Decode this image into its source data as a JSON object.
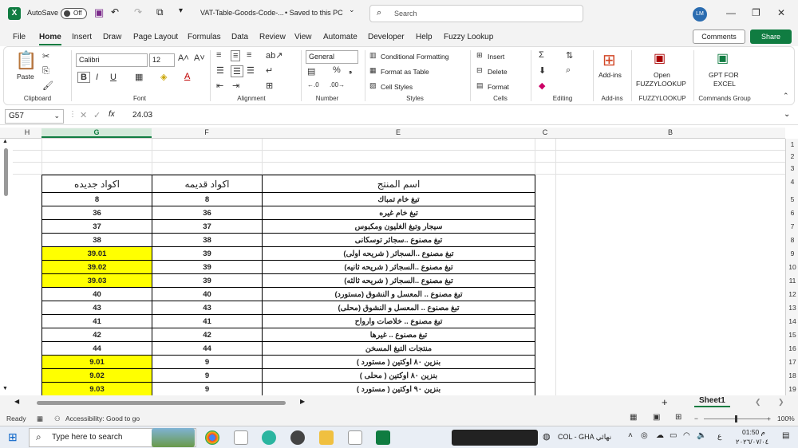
{
  "titlebar": {
    "autosave_label": "AutoSave",
    "autosave_state": "Off",
    "filename": "VAT-Table-Goods-Code-...",
    "save_status": "• Saved to this PC",
    "save_status_chevron": "⌄",
    "search_placeholder": "Search",
    "user_initials": "LM",
    "minimize": "—",
    "restore": "❐",
    "close": "✕"
  },
  "menu": {
    "items": [
      "File",
      "Home",
      "Insert",
      "Draw",
      "Page Layout",
      "Formulas",
      "Data",
      "Review",
      "View",
      "Automate",
      "Developer",
      "Help",
      "Fuzzy Lookup"
    ],
    "comments_label": "Comments",
    "share_label": "Share"
  },
  "ribbon": {
    "clipboard": {
      "paste": "Paste",
      "label": "Clipboard"
    },
    "font": {
      "name": "Calibri",
      "size": "12",
      "bold": "B",
      "italic": "I",
      "underline": "U",
      "label": "Font"
    },
    "alignment": {
      "label": "Alignment"
    },
    "number": {
      "format": "General",
      "label": "Number"
    },
    "styles": {
      "conditional": "Conditional Formatting",
      "format_table": "Format as Table",
      "cell_styles": "Cell Styles",
      "label": "Styles"
    },
    "cells": {
      "insert": "Insert",
      "delete": "Delete",
      "format": "Format",
      "label": "Cells"
    },
    "editing": {
      "label": "Editing"
    },
    "addins": {
      "button": "Add-ins",
      "label": "Add-ins"
    },
    "fuzzy": {
      "button_line1": "Open",
      "button_line2": "FUZZYLOOKUP",
      "label": "FUZZYLOOKUP"
    },
    "gpt": {
      "button_line1": "GPT FOR",
      "button_line2": "EXCEL",
      "label": "Commands Group"
    }
  },
  "formula_bar": {
    "cell_ref": "G57",
    "fx": "fx",
    "value": "24.03"
  },
  "grid": {
    "columns": [
      "H",
      "G",
      "F",
      "E",
      "C",
      "B"
    ],
    "selected_column": "G",
    "rows": [
      "1",
      "2",
      "3",
      "4",
      "5",
      "6",
      "7",
      "8",
      "9",
      "10",
      "11",
      "12",
      "13",
      "14",
      "15",
      "16",
      "17",
      "18",
      "19"
    ]
  },
  "table": {
    "headers": {
      "new_codes": "اكواد جديده",
      "old_codes": "اكواد قديمه",
      "product_name": "اسم المنتج"
    },
    "rows": [
      {
        "new": "8",
        "old": "8",
        "name": "تبغ خام تمباك",
        "highlight": false
      },
      {
        "new": "36",
        "old": "36",
        "name": "تبغ خام غيره",
        "highlight": false
      },
      {
        "new": "37",
        "old": "37",
        "name": "سيجار وتبغ الغليون ومكبوس",
        "highlight": false
      },
      {
        "new": "38",
        "old": "38",
        "name": "تبغ مصنوع ..سجائر توسكانى",
        "highlight": false
      },
      {
        "new": "39.01",
        "old": "39",
        "name": "تبغ مصنوع ..السجائر ( شريحه اولى)",
        "highlight": true
      },
      {
        "new": "39.02",
        "old": "39",
        "name": "تبغ مصنوع ..السجائر ( شريحه ثانيه)",
        "highlight": true
      },
      {
        "new": "39.03",
        "old": "39",
        "name": "تبغ مصنوع ..السجائر ( شريحه ثالثه)",
        "highlight": true
      },
      {
        "new": "40",
        "old": "40",
        "name": "تبغ مصنوع .. المعسل و النشوق (مستورد)",
        "highlight": false
      },
      {
        "new": "43",
        "old": "43",
        "name": "تبغ مصنوع .. المعسل و النشوق (محلى)",
        "highlight": false
      },
      {
        "new": "41",
        "old": "41",
        "name": "تبغ مصنوع .. خلاصات وارواح",
        "highlight": false
      },
      {
        "new": "42",
        "old": "42",
        "name": "تبغ مصنوع .. غيرها",
        "highlight": false
      },
      {
        "new": "44",
        "old": "44",
        "name": "منتجات التبغ المسخن",
        "highlight": false
      },
      {
        "new": "9.01",
        "old": "9",
        "name": "بنزين ٨٠ اوكتين ( مستورد )",
        "highlight": true
      },
      {
        "new": "9.02",
        "old": "9",
        "name": "بنزين ٨٠ اوكتين ( محلى )",
        "highlight": true
      },
      {
        "new": "9.03",
        "old": "9",
        "name": "بنزين ٩٠ اوكتين ( مستورد )",
        "highlight": true
      }
    ]
  },
  "sheet_tabs": {
    "active": "Sheet1",
    "add": "+"
  },
  "status": {
    "ready": "Ready",
    "accessibility": "Accessibility: Good to go",
    "zoom": "100%",
    "zoom_level": 1.0
  },
  "taskbar": {
    "search_placeholder": "Type here to search",
    "network_label": "COL - GHA نهائي",
    "lang": "ع",
    "time": "01:50 م",
    "date": "٢٠٢٦/٠٧/٠٤"
  },
  "colors": {
    "accent": "#107c41",
    "highlight": "#ffff00"
  }
}
